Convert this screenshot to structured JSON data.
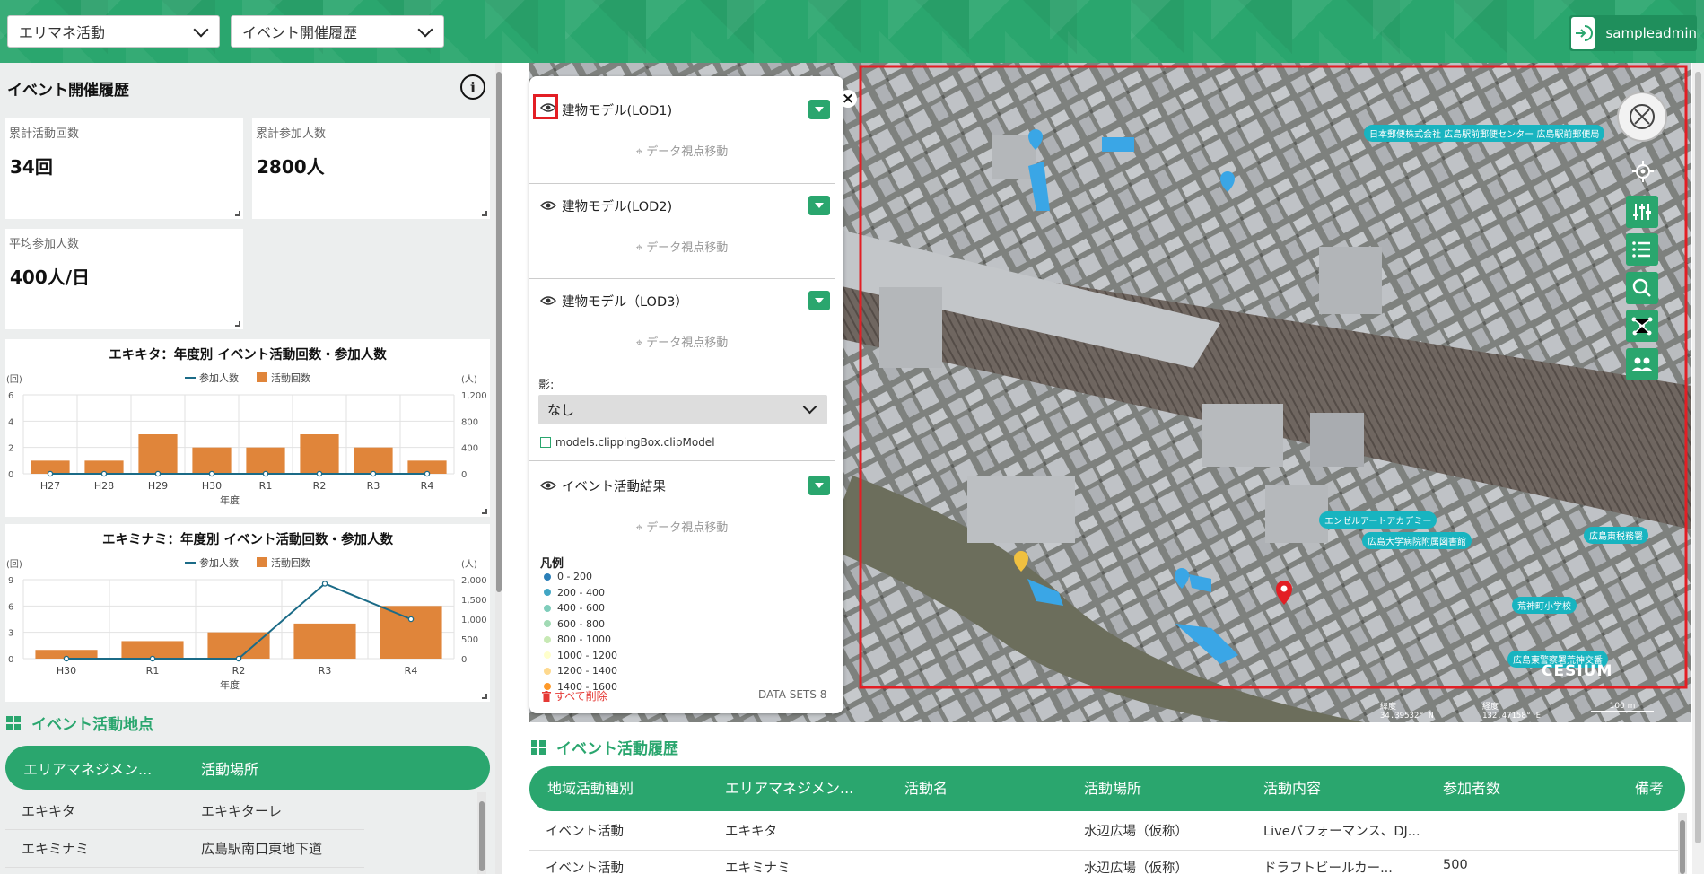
{
  "header": {
    "select_category": "エリマネ活動",
    "select_view": "イベント開催履歴",
    "username": "sampleadmin"
  },
  "left": {
    "title": "イベント開催履歴",
    "stats": [
      {
        "label": "累計活動回数",
        "value": "34回"
      },
      {
        "label": "累計参加人数",
        "value": "2800人"
      },
      {
        "label": "平均参加人数",
        "value": "400人/日"
      }
    ],
    "locations_title": "イベント活動地点",
    "locations_header": {
      "col1": "エリアマネジメン...",
      "col2": "活動場所"
    },
    "locations_rows": [
      {
        "col1": "エキキタ",
        "col2": "エキキターレ"
      },
      {
        "col1": "エキミナミ",
        "col2": "広島駅南口東地下道"
      }
    ]
  },
  "chart_data": [
    {
      "type": "bar",
      "title": "エキキタ：年度別 イベント活動回数・参加人数",
      "categories": [
        "H27",
        "H28",
        "H29",
        "H30",
        "R1",
        "R2",
        "R3",
        "R4"
      ],
      "series": [
        {
          "name": "活動回数",
          "type": "bar",
          "axis": "left",
          "color": "#e0853a",
          "values": [
            1,
            1,
            3,
            2,
            2,
            3,
            2,
            1
          ]
        },
        {
          "name": "参加人数",
          "type": "line",
          "axis": "right",
          "color": "#1b6b87",
          "values": [
            0,
            0,
            0,
            0,
            0,
            0,
            0,
            0
          ]
        }
      ],
      "xlabel": "年度",
      "ylabel_left": "(回)",
      "ylabel_right": "(人)",
      "yticks_left": [
        "0",
        "2",
        "4",
        "6"
      ],
      "yticks_right": [
        "0",
        "400",
        "800",
        "1,200"
      ],
      "ylim_left": [
        0,
        6
      ],
      "ylim_right": [
        0,
        1200
      ],
      "legend": "top-center",
      "grid": true
    },
    {
      "type": "bar",
      "title": "エキミナミ：年度別 イベント活動回数・参加人数",
      "categories": [
        "H30",
        "R1",
        "R2",
        "R3",
        "R4"
      ],
      "series": [
        {
          "name": "活動回数",
          "type": "bar",
          "axis": "left",
          "color": "#e0853a",
          "values": [
            1,
            2,
            3,
            4,
            6
          ]
        },
        {
          "name": "参加人数",
          "type": "line",
          "axis": "right",
          "color": "#1b6b87",
          "values": [
            0,
            0,
            0,
            1900,
            1000
          ]
        }
      ],
      "xlabel": "年度",
      "ylabel_left": "(回)",
      "ylabel_right": "(人)",
      "yticks_left": [
        "0",
        "3",
        "6",
        "9"
      ],
      "yticks_right": [
        "0",
        "500",
        "1,000",
        "1,500",
        "2,000"
      ],
      "ylim_left": [
        0,
        9
      ],
      "ylim_right": [
        0,
        2000
      ],
      "legend": "top-center",
      "grid": true
    }
  ],
  "layers": {
    "items": [
      {
        "name": "建物モデル(LOD1)",
        "nav": "データ視点移動"
      },
      {
        "name": "建物モデル(LOD2)",
        "nav": "データ視点移動"
      },
      {
        "name": "建物モデル（LOD3）",
        "nav": "データ視点移動"
      },
      {
        "name": "イベント活動結果",
        "nav": "データ視点移動"
      }
    ],
    "shadow_label": "影:",
    "shadow_value": "なし",
    "clip_label": "models.clippingBox.clipModel",
    "legend_title": "凡例",
    "legend": [
      {
        "label": "0 - 200",
        "color": "#2c7fb8"
      },
      {
        "label": "200 - 400",
        "color": "#41a6c4"
      },
      {
        "label": "400 - 600",
        "color": "#7fcdbb"
      },
      {
        "label": "600 - 800",
        "color": "#a1dab4"
      },
      {
        "label": "800 - 1000",
        "color": "#c7e9b4"
      },
      {
        "label": "1000 - 1200",
        "color": "#ffffcc"
      },
      {
        "label": "1200 - 1400",
        "color": "#fed98e"
      },
      {
        "label": "1400 - 1600",
        "color": "#fe9929"
      }
    ],
    "delete_all": "すべて削除",
    "datasets": "DATA SETS 8"
  },
  "map": {
    "labels": [
      "日本郵便株式会社 広島駅前郵便センター 広島駅前郵便局",
      "エンゼルアートアカデミー",
      "広島大学病院附属図書館",
      "広島東税務署",
      "荒神町小学校",
      "広島東警察署荒神交番"
    ],
    "latitude_label": "緯度",
    "latitude": "34.39532° N",
    "longitude_label": "経度",
    "longitude": "132.47158° E",
    "scale": "100 m",
    "cesium": "CESIUM"
  },
  "history": {
    "title": "イベント活動履歴",
    "columns": [
      "地域活動種別",
      "エリアマネジメン...",
      "活動名",
      "活動場所",
      "活動内容",
      "参加者数",
      "備考"
    ],
    "rows": [
      [
        "イベント活動",
        "エキキタ",
        "",
        "水辺広場（仮称）",
        "Liveパフォーマンス、DJ...",
        "",
        ""
      ],
      [
        "イベント活動",
        "エキミナミ",
        "",
        "水辺広場（仮称）",
        "ドラフトビールカー...",
        "500",
        ""
      ]
    ]
  },
  "colors": {
    "primary": "#2aa66e",
    "bar": "#e0853a",
    "line": "#1b6b87",
    "highlight": "#e31e24"
  }
}
